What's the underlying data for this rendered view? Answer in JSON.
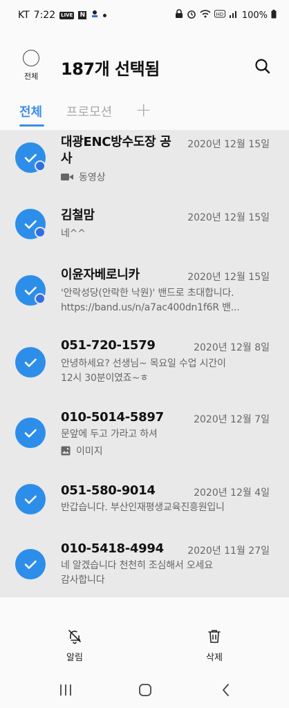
{
  "status_bar": {
    "carrier": "KT",
    "time": "7:22",
    "live_badge": "LIVE",
    "n_badge": "N",
    "battery": "100%"
  },
  "header": {
    "select_all_label": "전체",
    "title": "187개 선택됨",
    "search_icon": "search-icon"
  },
  "tabs": [
    {
      "label": "전체"
    },
    {
      "label": "프로모션"
    },
    {
      "label": "+"
    }
  ],
  "messages": [
    {
      "name": "대광ENC방수도장 공사",
      "date": "2020년 12월 15일",
      "attachment": "동영상",
      "attachment_icon": "video-icon",
      "selected": true
    },
    {
      "name": "김철맘",
      "date": "2020년 12월 15일",
      "preview": "네^^",
      "selected": true
    },
    {
      "name": "이윤자베로니카",
      "date": "2020년 12월 15일",
      "preview": "'안락성당(안락한 낙원)' 밴드로 초대합니다.",
      "preview2": "https://band.us/n/a7ac400dn1f6R 밴...",
      "selected": true
    },
    {
      "name": "051-720-1579",
      "date": "2020년 12월 8일",
      "preview": "안녕하세요? 선생님~ 목요일 수업 시간이",
      "preview2": "12시 30분이였죠~ㅎ",
      "selected": true
    },
    {
      "name": "010-5014-5897",
      "date": "2020년 12월 7일",
      "preview": "문앞에 두고 가라고 하셔",
      "attachment": "이미지",
      "attachment_icon": "image-icon",
      "selected": true
    },
    {
      "name": "051-580-9014",
      "date": "2020년 12월 4일",
      "preview": "반갑습니다. 부산인재평생교육진흥원입니",
      "selected": true
    },
    {
      "name": "010-5418-4994",
      "date": "2020년 11월 27일",
      "preview": "네 알겠습니다 천천히 조심해서 오세요",
      "preview2": "감사합니다",
      "selected": true
    }
  ],
  "actions": {
    "notify_label": "알림",
    "delete_label": "삭제"
  },
  "colors": {
    "accent": "#3b8ee6",
    "check": "#2d8eea",
    "list_bg": "#e9e9e9"
  }
}
